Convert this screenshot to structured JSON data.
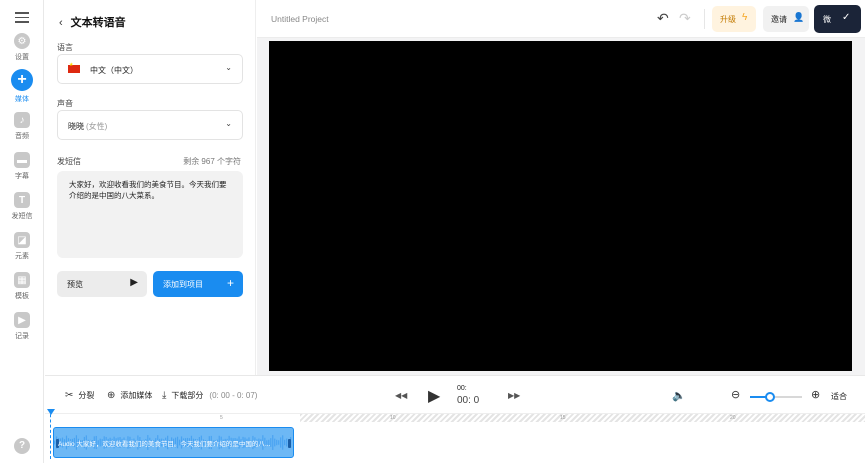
{
  "sidebar": {
    "items": [
      {
        "label": "设置",
        "icon": "gear-icon",
        "active": false
      },
      {
        "label": "媒体",
        "icon": "plus-icon",
        "active": true
      },
      {
        "label": "音频",
        "icon": "music-note-icon",
        "active": false
      },
      {
        "label": "字幕",
        "icon": "subtitles-icon",
        "active": false
      },
      {
        "label": "发短信",
        "icon": "text-icon",
        "active": false
      },
      {
        "label": "元素",
        "icon": "shapes-icon",
        "active": false
      },
      {
        "label": "模板",
        "icon": "template-icon",
        "active": false
      },
      {
        "label": "记录",
        "icon": "record-icon",
        "active": false
      }
    ],
    "help": "?"
  },
  "panel": {
    "title": "文本转语音",
    "language_label": "语言",
    "language_value": "中文（中文）",
    "voice_label": "声音",
    "voice_name": "晓晓",
    "voice_gender": "(女性)",
    "text_label": "发短信",
    "remaining": "剩余 967 个字符",
    "text_content": "大家好，欢迎收看我们的美食节目。今天我们要介绍的是中国的八大菜系。",
    "preview_label": "预览",
    "add_label": "添加到项目"
  },
  "header": {
    "project_title": "Untitled Project",
    "upgrade_label": "升级",
    "invite_label": "邀请",
    "finish_label": "微"
  },
  "playback": {
    "split_label": "分裂",
    "add_media_label": "添加媒体",
    "download_label": "下载部分",
    "download_range": "(0: 00 - 0: 07)",
    "timecode_top": "00:",
    "timecode_bottom": "00: 0",
    "zoom_level": 0.38,
    "fit_label": "适合"
  },
  "timeline": {
    "ticks": [
      "5",
      "10",
      "15",
      "20"
    ],
    "clip_label": "Audio 大家好，欢迎收看我们的美食节目。今天我们要介绍的是中国的八...",
    "accent": "#1a8cf0"
  },
  "colors": {
    "accent": "#1a8cf0",
    "finish_button": "#1b2438",
    "upgrade_bg": "#fff3df"
  }
}
